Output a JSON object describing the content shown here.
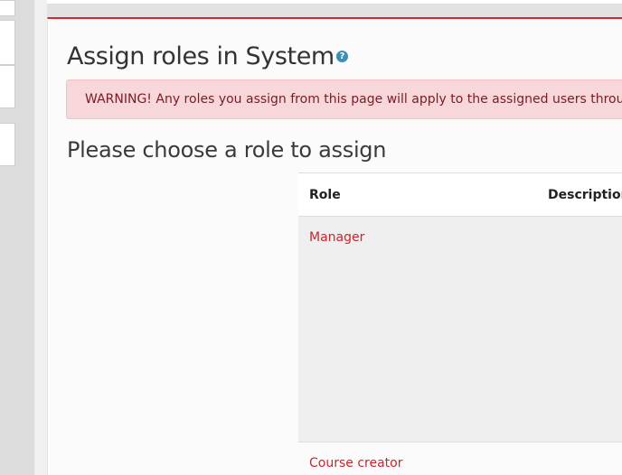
{
  "header": {
    "page_title": "Assign roles in System",
    "help_icon": "question-circle-icon"
  },
  "alert": {
    "text": "WARNING! Any roles you assign from this page will apply to the assigned users throughout"
  },
  "section": {
    "heading": "Please choose a role to assign"
  },
  "roles_table": {
    "columns": [
      "Role",
      "Description"
    ],
    "rows": [
      {
        "role": "Manager"
      },
      {
        "role": "Course creator"
      }
    ]
  },
  "colors": {
    "brand_red": "#d9262d",
    "link_red": "#c8252d",
    "alert_bg": "#f8d7da",
    "help_blue": "#3a8fb7"
  }
}
